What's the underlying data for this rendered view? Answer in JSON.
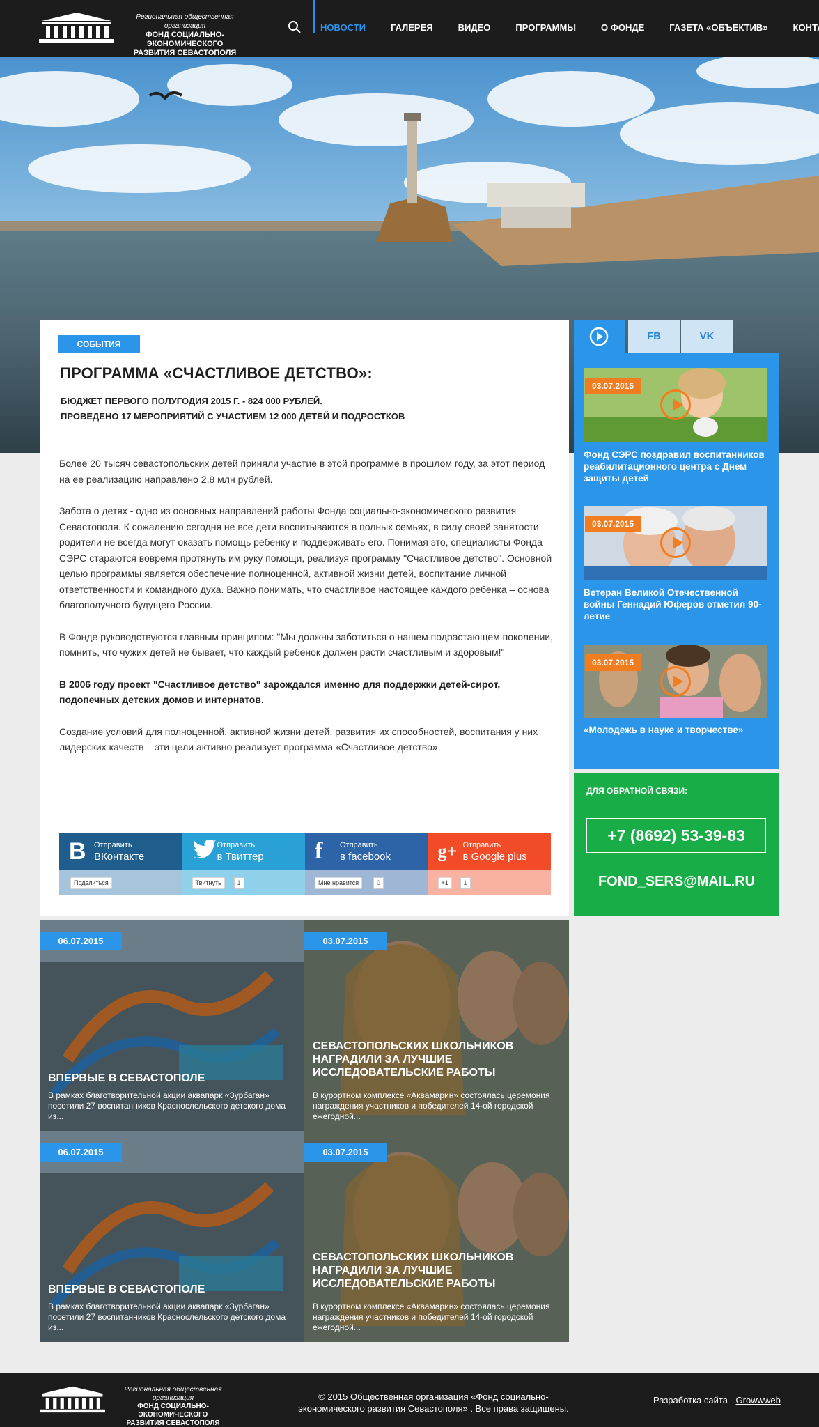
{
  "header": {
    "logo_small": "Региональная общественная организация",
    "logo_line1": "ФОНД СОЦИАЛЬНО-ЭКОНОМИЧЕСКОГО",
    "logo_line2": "РАЗВИТИЯ СЕВАСТОПОЛЯ",
    "nav": [
      "НОВОСТИ",
      "ГАЛЕРЕЯ",
      "ВИДЕО",
      "ПРОГРАММЫ",
      "О ФОНДЕ",
      "ГАЗЕТА «ОБЪЕКТИВ»",
      "КОНТАКТЫ"
    ]
  },
  "article": {
    "category": "СОБЫТИЯ",
    "title": "ПРОГРАММА «СЧАСТЛИВОЕ ДЕТСТВО»:",
    "lead1": "БЮДЖЕТ ПЕРВОГО ПОЛУГОДИЯ 2015 Г. - 824 000 РУБЛЕЙ.",
    "lead2": "ПРОВЕДЕНО 17 МЕРОПРИЯТИЙ С УЧАСТИЕМ 12 000 ДЕТЕЙ И ПОДРОСТКОВ",
    "p1": "Более 20 тысяч севастопольских детей приняли участие в этой программе в прошлом году, за этот период на ее реализацию направлено 2,8 млн рублей.",
    "p2": "Забота о детях - одно из основных направлений работы Фонда социально-экономического развития Севастополя. К сожалению сегодня не все дети воспитываются в полных семьях, в силу своей занятости родители не всегда могут оказать помощь ребенку и поддерживать его. Понимая это, специалисты Фонда СЭРС стараются вовремя протянуть им руку помощи, реализуя программу \"Счастливое детство\". Основной целью программы является обеспечение полноценной, активной жизни детей, воспитание личной ответственности и командного духа. Важно понимать, что счастливое настоящее каждого ребенка – основа благополучного будущего России.",
    "p3": "В Фонде руководствуются главным принципом: \"Мы должны заботиться о нашем подрастающем поколении, помнить, что чужих детей не бывает, что каждый ребенок должен расти счастливым и здоровым!\"",
    "p4": "В 2006 году проект \"Счастливое детство\" зарождался именно для поддержки детей-сирот, подопечных детских домов и интернатов.",
    "p5": "Создание условий для полноценной, активной жизни детей, развития их способностей, воспитания у них лидерских качеств – эти цели активно реализует программа «Счастливое детство»."
  },
  "share": {
    "vk": {
      "l1": "Отправить",
      "l2": "ВКонтакте",
      "btn": "Поделиться",
      "count": ""
    },
    "tw": {
      "l1": "Отправить",
      "l2": "в Твиттер",
      "btn": "Твитнуть",
      "count": "1"
    },
    "fb": {
      "l1": "Отправить",
      "l2": "в facebook",
      "btn": "Мне нравится",
      "count": "0"
    },
    "gp": {
      "l1": "Отправить",
      "l2": "в Google plus",
      "btn": "+1",
      "count": "1"
    }
  },
  "news": [
    {
      "date": "06.07.2015",
      "title": "ВПЕРВЫЕ В СЕВАСТОПОЛЕ",
      "text": "В рамках благотворительной акции аквапарк «Зурбаган» посетили 27 воспитанников Краснослельского детского дома из..."
    },
    {
      "date": "03.07.2015",
      "title": "СЕВАСТОПОЛЬСКИХ ШКОЛЬНИКОВ НАГРАДИЛИ ЗА ЛУЧШИЕ ИССЛЕДОВАТЕЛЬСКИЕ РАБОТЫ",
      "text": "В курортном комплексе «Аквамарин» состоялась церемония награждения участников и победителей 14-ой городской ежегодной..."
    },
    {
      "date": "06.07.2015",
      "title": "ВПЕРВЫЕ В СЕВАСТОПОЛЕ",
      "text": "В рамках благотворительной акции аквапарк «Зурбаган» посетили 27 воспитанников Краснослельского детского дома из..."
    },
    {
      "date": "03.07.2015",
      "title": "СЕВАСТОПОЛЬСКИХ ШКОЛЬНИКОВ НАГРАДИЛИ ЗА ЛУЧШИЕ ИССЛЕДОВАТЕЛЬСКИЕ РАБОТЫ",
      "text": "В курортном комплексе «Аквамарин» состоялась церемония награждения участников и победителей 14-ой городской ежегодной..."
    }
  ],
  "sidebar": {
    "tabs": {
      "fb": "FB",
      "vk": "VK"
    },
    "videos": [
      {
        "date": "03.07.2015",
        "title": "Фонд СЭРС поздравил воспитанников реабилитационного центра с Днем защиты детей"
      },
      {
        "date": "03.07.2015",
        "title": "Ветеран Великой Отечественной войны Геннадий Юферов отметил 90-летие"
      },
      {
        "date": "03.07.2015",
        "title": "«Молодежь в науке и творчестве»"
      }
    ],
    "contact_label": "ДЛЯ ОБРАТНОЙ СВЯЗИ:",
    "phone": "+7 (8692) 53-39-83",
    "email": "FOND_SERS@MAIL.RU"
  },
  "footer": {
    "logo_small": "Региональная общественная организация",
    "logo_line1": "ФОНД СОЦИАЛЬНО-ЭКОНОМИЧЕСКОГО",
    "logo_line2": "РАЗВИТИЯ СЕВАСТОПОЛЯ",
    "copyright": "© 2015 Общественная организация «Фонд социально-экономического развития Севастополя» . Все права защищены.",
    "dev_label": "Разработка сайта -",
    "dev_link": "Growwweb"
  },
  "colors": {
    "accent": "#2a95e9",
    "header": "#1c1c1c",
    "contact": "#18ad46",
    "video_badge": "#f07d1f"
  }
}
